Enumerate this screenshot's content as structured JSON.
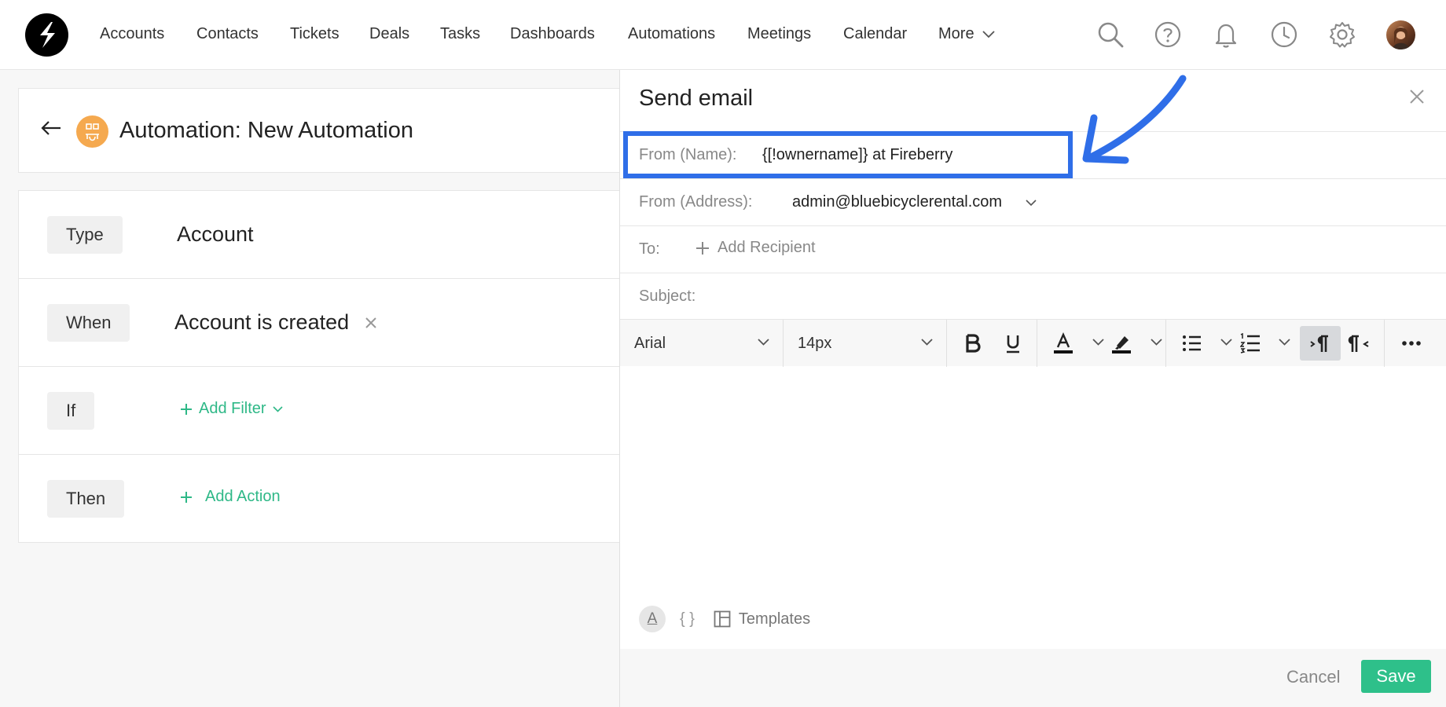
{
  "nav": {
    "items": [
      "Accounts",
      "Contacts",
      "Tickets",
      "Deals",
      "Tasks",
      "Dashboards",
      "Automations",
      "Meetings",
      "Calendar"
    ],
    "more_label": "More"
  },
  "automation": {
    "title": "Automation: New Automation",
    "rules": {
      "type_label": "Type",
      "type_value": "Account",
      "when_label": "When",
      "when_value": "Account is created",
      "if_label": "If",
      "add_filter": "Add Filter",
      "then_label": "Then",
      "add_action": "Add Action"
    }
  },
  "email": {
    "title": "Send email",
    "from_name_label": "From (Name):",
    "from_name_value": "{[!ownername]} at Fireberry",
    "from_address_label": "From (Address):",
    "from_address_value": "admin@bluebicyclerental.com",
    "to_label": "To:",
    "add_recipient": "Add Recipient",
    "subject_label": "Subject:",
    "font_family": "Arial",
    "font_size": "14px",
    "templates_label": "Templates",
    "braces_label": "{ }",
    "format_a_label": "A",
    "cancel_label": "Cancel",
    "save_label": "Save"
  },
  "colors": {
    "accent_green": "#2ec08a",
    "highlight_blue": "#2f6ee8",
    "automation_icon": "#f5a94f"
  }
}
